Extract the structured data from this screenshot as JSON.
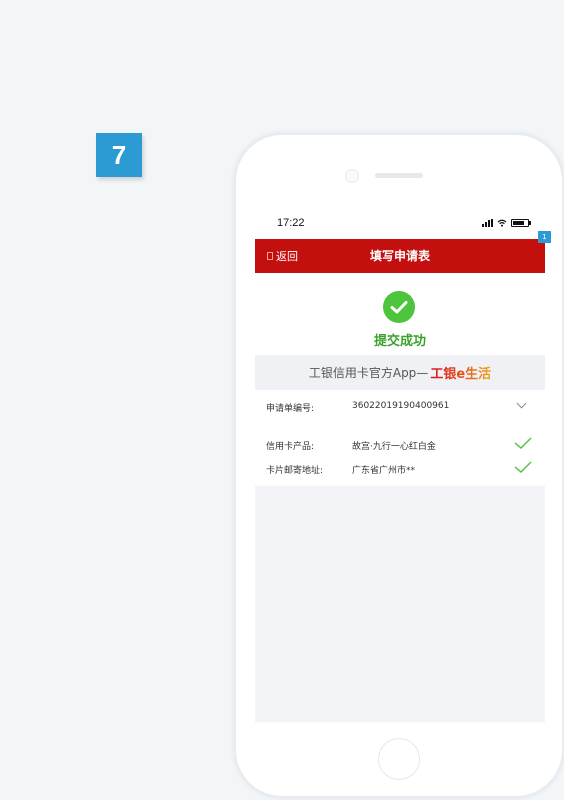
{
  "step": {
    "number": "7"
  },
  "status_bar": {
    "time": "17:22"
  },
  "corner_tag": "1",
  "nav": {
    "back_label": "返回",
    "title": "填写申请表"
  },
  "success": {
    "text": "提交成功"
  },
  "promo": {
    "prefix": "工银信用卡官方App—",
    "brand": "工银e生活"
  },
  "info": [
    {
      "label": "申请单编号:",
      "value": "36022019190400961",
      "icon": "chevron-down-icon"
    },
    {
      "label": "信用卡产品:",
      "value": "故宫·九行一心红白金",
      "icon": "check-icon"
    },
    {
      "label": "卡片邮寄地址:",
      "value": "广东省广州市**",
      "icon": "check-icon"
    }
  ],
  "colors": {
    "nav_red": "#c40f0f",
    "success_green": "#4cc43b",
    "step_blue": "#2d9bd3"
  }
}
